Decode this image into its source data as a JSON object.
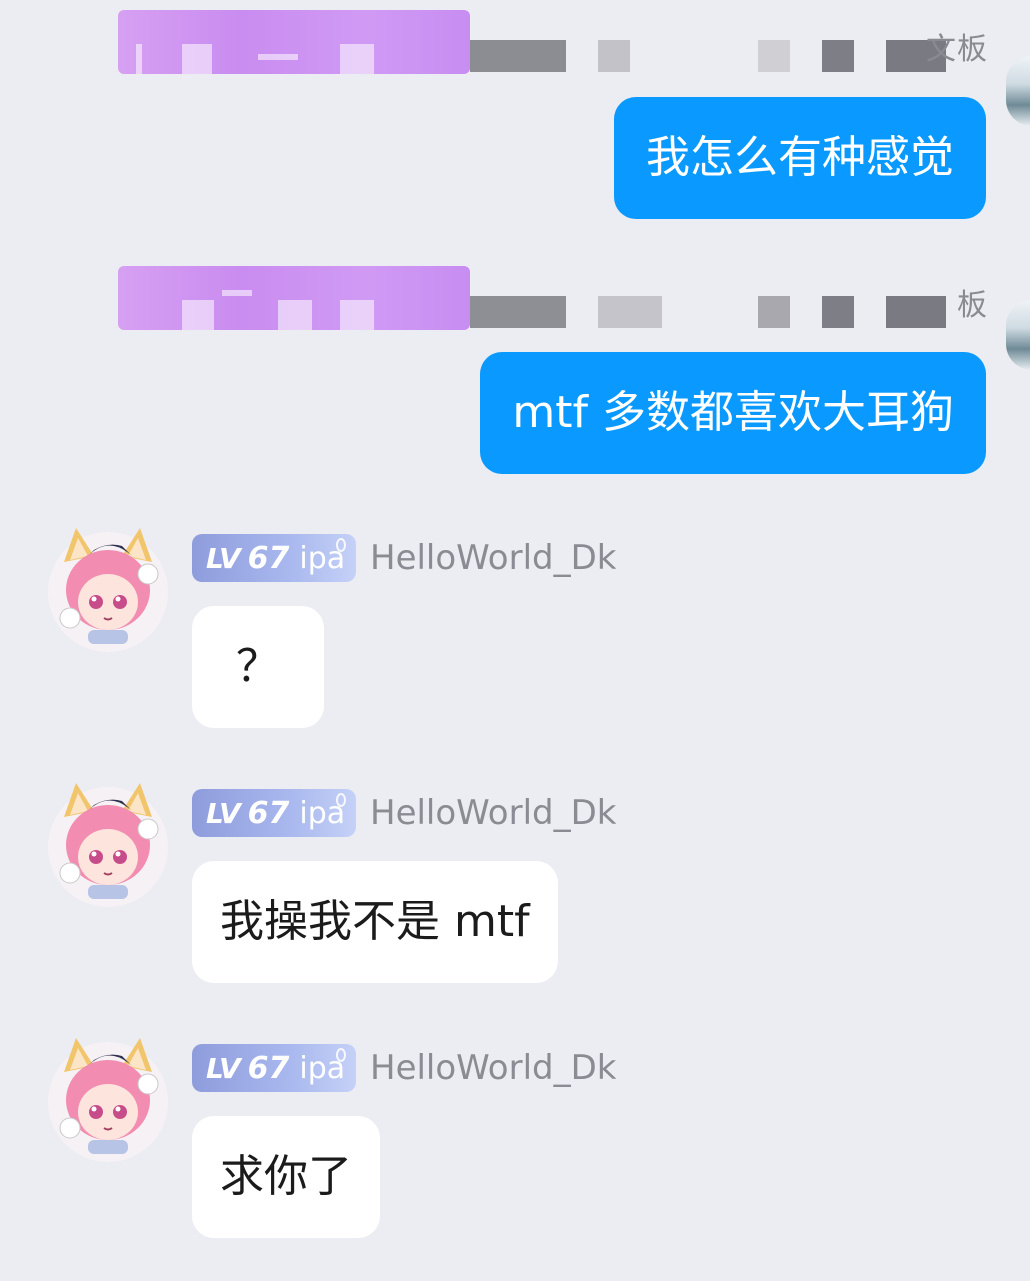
{
  "theme": {
    "background": "#ecedf2",
    "outgoing_bubble": "#0a99ff",
    "incoming_bubble": "#ffffff",
    "badge_gradient_start": "#8e9cdc",
    "badge_gradient_end": "#c5d1f7",
    "redaction_purple": "#c98cf0",
    "username_color": "#8b8b93"
  },
  "messages": [
    {
      "direction": "out",
      "sender_tag": "文板",
      "text": "我怎么有种感觉"
    },
    {
      "direction": "out",
      "sender_tag": "板",
      "text": "mtf 多数都喜欢大耳狗"
    },
    {
      "direction": "in",
      "level_prefix": "LV",
      "level": "67",
      "title": "ipa",
      "username": "HelloWorld_Dk",
      "avatar_icon": "anime-girl-avatar-icon",
      "text": "？"
    },
    {
      "direction": "in",
      "level_prefix": "LV",
      "level": "67",
      "title": "ipa",
      "username": "HelloWorld_Dk",
      "avatar_icon": "anime-girl-avatar-icon",
      "text": "我操我不是 mtf"
    },
    {
      "direction": "in",
      "level_prefix": "LV",
      "level": "67",
      "title": "ipa",
      "username": "HelloWorld_Dk",
      "avatar_icon": "anime-girl-avatar-icon",
      "text": "求你了"
    }
  ]
}
